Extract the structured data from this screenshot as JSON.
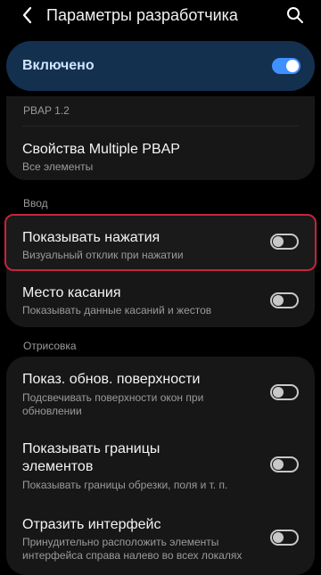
{
  "header": {
    "back_icon": "chevron-left-icon",
    "title": "Параметры разработчика",
    "search_icon": "search-icon"
  },
  "master_switch": {
    "label": "Включено",
    "state": true,
    "color": "#3e91ff"
  },
  "pbap": {
    "header": "PBAP 1.2",
    "items": [
      {
        "title": "Свойства Multiple PBAP",
        "subtitle": "Все элементы"
      }
    ]
  },
  "input": {
    "header": "Ввод",
    "items": [
      {
        "title": "Показывать нажатия",
        "subtitle": "Визуальный отклик при нажатии",
        "toggle": false,
        "highlighted": true
      },
      {
        "title": "Место касания",
        "subtitle": "Показывать данные касаний и жестов",
        "toggle": false
      }
    ]
  },
  "drawing": {
    "header": "Отрисовка",
    "items": [
      {
        "title": "Показ. обнов. поверхности",
        "subtitle_line1": "Подсвечивать поверхности окон при",
        "subtitle_line2": "обновлении",
        "toggle": false
      },
      {
        "title_line1": "Показывать границы",
        "title_line2": "элементов",
        "subtitle": "Показывать границы обрезки, поля и т. п.",
        "toggle": false
      },
      {
        "title": "Отразить интерфейс",
        "subtitle_line1": "Принудительно расположить элементы",
        "subtitle_line2": "интерфейса справа налево во всех локалях",
        "toggle": false
      }
    ]
  },
  "colors": {
    "accent": "#3e91ff",
    "highlight_border": "#c6243d"
  }
}
